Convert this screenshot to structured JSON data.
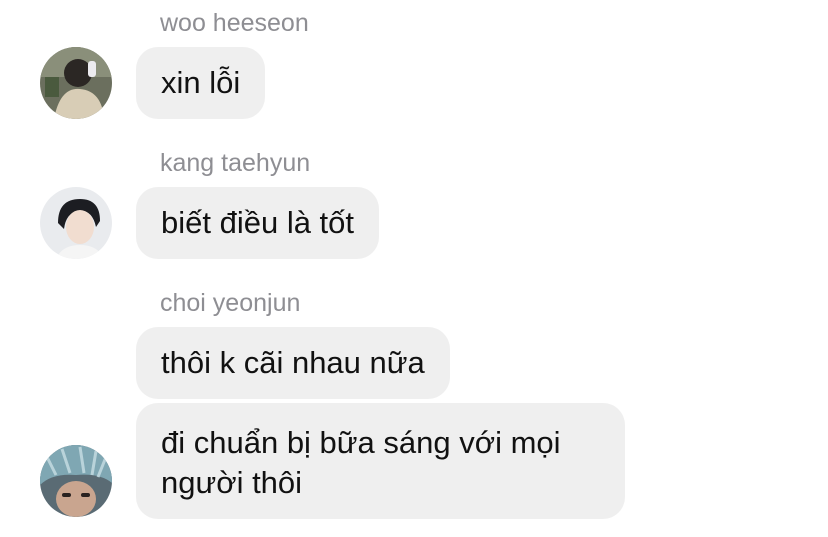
{
  "colors": {
    "bubble_bg": "#efefef",
    "sender_text": "#8e8e93",
    "message_text": "#111111"
  },
  "messages": [
    {
      "sender": "woo heeseon",
      "avatar": "avatar-photo-1",
      "text": "xin lỗi"
    },
    {
      "sender": "kang taehyun",
      "avatar": "avatar-photo-2",
      "text": "biết điều là tốt"
    },
    {
      "sender": "choi yeonjun",
      "avatar": "avatar-photo-3",
      "texts": [
        "thôi k cãi nhau nữa",
        "đi chuẩn bị bữa sáng với mọi người thôi"
      ]
    }
  ]
}
